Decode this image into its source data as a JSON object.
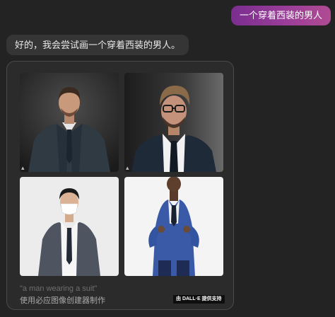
{
  "chat": {
    "user_message": "一个穿着西装的男人",
    "bot_message": "好的，我会尝试画一个穿着西装的男人。"
  },
  "image_card": {
    "images": [
      {
        "alt": "man in dark suit, dark background"
      },
      {
        "alt": "man with glasses and beard in suit"
      },
      {
        "alt": "man wearing face mask in grey suit"
      },
      {
        "alt": "man in blue suit adjusting jacket"
      }
    ],
    "prompt": "\"a man wearing a suit\"",
    "caption": "使用必应图像创建器制作",
    "badge": "由 DALL·E 提供支持"
  },
  "colors": {
    "background": "#232323",
    "bot_bubble": "#353535",
    "user_bubble_gradient": [
      "#7a2e8f",
      "#b04b93"
    ],
    "card_border": "#4a4a4a"
  }
}
